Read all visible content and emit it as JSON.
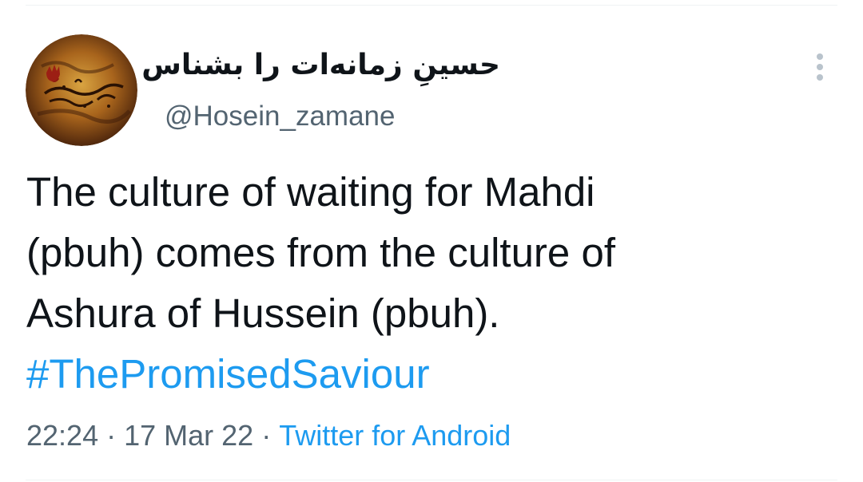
{
  "author": {
    "display_name": "حسینِ زمانه‌ات را بشناس",
    "handle": "@Hosein_zamane",
    "avatar_icon": "calligraphy-avatar"
  },
  "tweet": {
    "lines": [
      "The culture of waiting for Mahdi",
      "(pbuh) comes from the culture of",
      "Ashura of Hussein (pbuh)."
    ],
    "hashtag": "#ThePromisedSaviour"
  },
  "meta": {
    "time": "22:24",
    "separator": "·",
    "date": "17 Mar 22",
    "source": "Twitter for Android"
  },
  "more_icon": "vertical-dots-icon",
  "colors": {
    "text": "#0f1419",
    "secondary": "#536471",
    "link": "#1d9bf0"
  }
}
